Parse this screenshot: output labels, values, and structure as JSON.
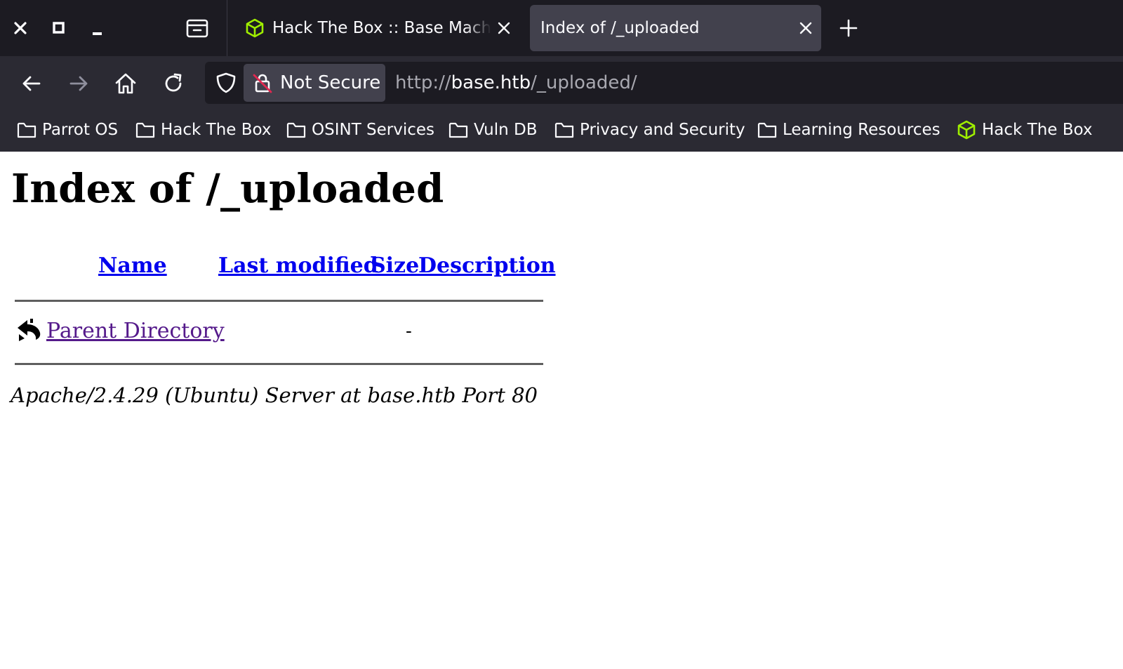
{
  "window": {
    "buttons": [
      "close",
      "maximize",
      "minimize"
    ]
  },
  "tabs": [
    {
      "title": "Hack The Box :: Base Machine",
      "active": false,
      "icon": "htb-cube-icon"
    },
    {
      "title": "Index of /_uploaded",
      "active": true
    }
  ],
  "navbar": {
    "security_label": "Not Secure",
    "url_scheme": "http://",
    "url_host": "base.htb",
    "url_path": "/_uploaded/"
  },
  "bookmarks": [
    {
      "label": "Parrot OS",
      "icon": "folder-icon"
    },
    {
      "label": "Hack The Box",
      "icon": "folder-icon"
    },
    {
      "label": "OSINT Services",
      "icon": "folder-icon"
    },
    {
      "label": "Vuln DB",
      "icon": "folder-icon"
    },
    {
      "label": "Privacy and Security",
      "icon": "folder-icon"
    },
    {
      "label": "Learning Resources",
      "icon": "folder-icon"
    },
    {
      "label": "Hack The Box",
      "icon": "htb-cube-icon"
    }
  ],
  "page": {
    "heading": "Index of /_uploaded",
    "columns": [
      "Name",
      "Last modified",
      "Size",
      "Description"
    ],
    "rows": [
      {
        "name": "Parent Directory",
        "last_modified": "",
        "size": "-",
        "description": ""
      }
    ],
    "server_signature": "Apache/2.4.29 (Ubuntu) Server at base.htb Port 80"
  },
  "colors": {
    "tabbar_bg": "#1c1b22",
    "toolbar_bg": "#2b2a33",
    "active_tab_bg": "#42414d",
    "htb_green": "#9fef00",
    "link_unvisited": "#0000ee",
    "link_visited": "#551a8b"
  }
}
